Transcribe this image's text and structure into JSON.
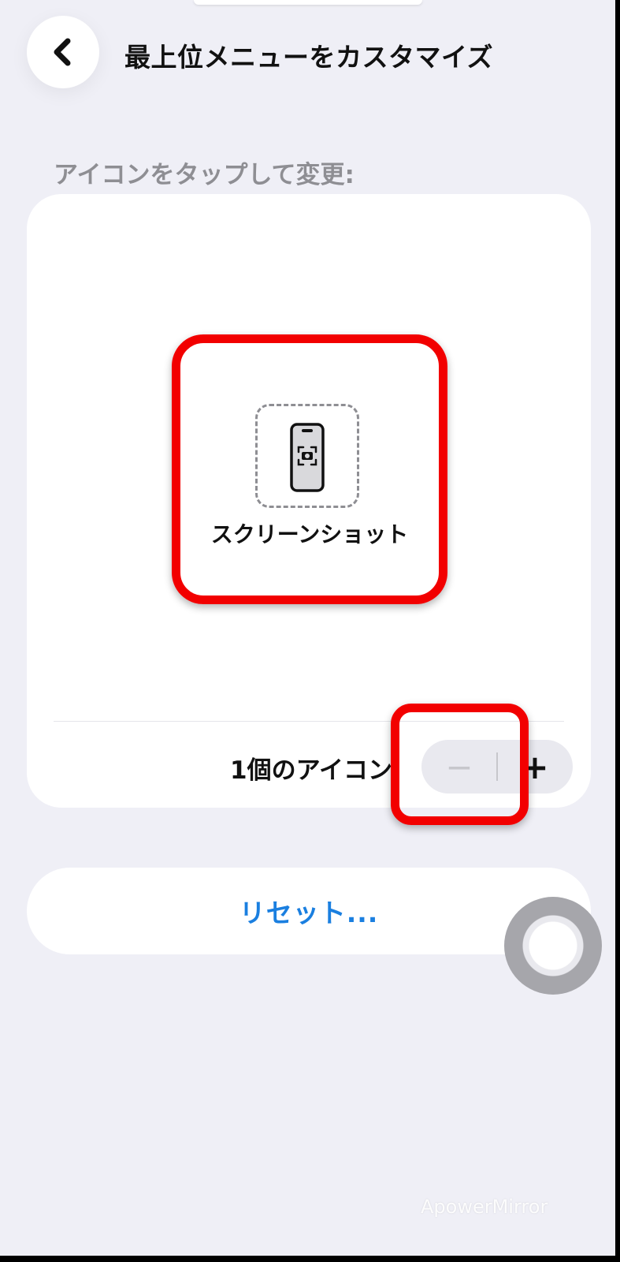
{
  "header": {
    "back_icon": "chevron-left-icon",
    "title": "最上位メニューをカスタマイズ"
  },
  "section": {
    "label": "アイコンをタップして変更:"
  },
  "menu": {
    "tile": {
      "icon": "screenshot-phone-icon",
      "label": "スクリーンショット"
    },
    "count_label": "1個のアイコン",
    "icon_count": 1,
    "stepper": {
      "minus": "−",
      "plus": "+"
    }
  },
  "reset": {
    "label": "リセット..."
  },
  "overlay": {
    "highlight_color": "#f20000",
    "watermark": "ApowerMirror"
  },
  "colors": {
    "background": "#efeff6",
    "accent": "#1a7fe0"
  }
}
